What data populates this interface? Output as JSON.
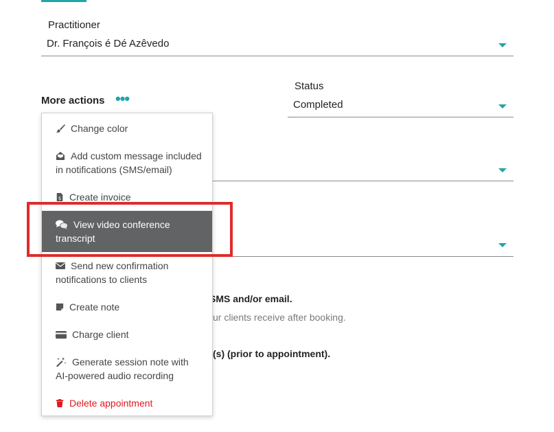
{
  "practitioner": {
    "label": "Practitioner",
    "value": "Dr. François é Dé Azêvedo"
  },
  "status": {
    "label": "Status",
    "value": "Completed"
  },
  "more_actions": {
    "label": "More actions",
    "dots": "•••"
  },
  "menu": {
    "items": [
      {
        "label_line1": "Change color",
        "label_line2": "",
        "icon": "paintbrush-icon"
      },
      {
        "label_line1": "Add custom message included",
        "label_line2": "in notifications (SMS/email)",
        "icon": "envelope-open-icon"
      },
      {
        "label_line1": "Create invoice",
        "label_line2": "",
        "icon": "invoice-icon"
      },
      {
        "label_line1": "View video conference",
        "label_line2": "transcript",
        "icon": "chat-bubbles-icon"
      },
      {
        "label_line1": "Send new confirmation",
        "label_line2": "notifications to clients",
        "icon": "envelope-icon"
      },
      {
        "label_line1": "Create note",
        "label_line2": "",
        "icon": "note-icon"
      },
      {
        "label_line1": "Charge client",
        "label_line2": "",
        "icon": "credit-card-icon"
      },
      {
        "label_line1": "Generate session note with",
        "label_line2": "AI-powered audio recording",
        "icon": "magic-wand-icon"
      },
      {
        "label_line1": "Delete appointment",
        "label_line2": "",
        "icon": "trash-icon"
      }
    ]
  },
  "background_text": {
    "sms_email": "SMS and/or email.",
    "after_booking": "ur clients receive after booking.",
    "prior": "(s) (prior to appointment)."
  },
  "colors": {
    "accent": "#21a5a8",
    "active_item_bg": "#616365",
    "danger": "#e0191e",
    "highlight": "#e02b2b"
  }
}
